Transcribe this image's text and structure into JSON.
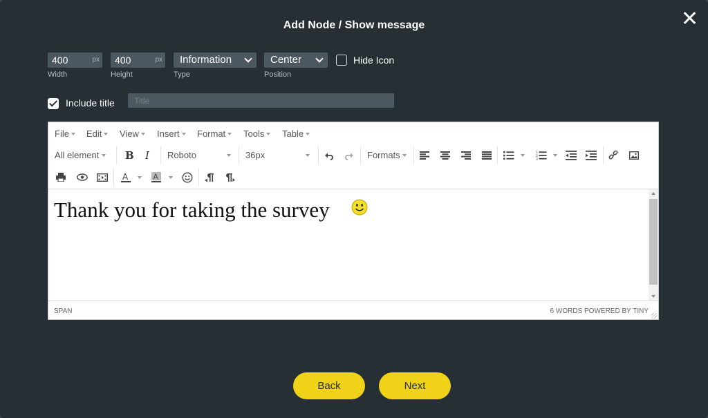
{
  "dialog": {
    "title": "Add Node / Show message"
  },
  "settings": {
    "width": {
      "value": "400",
      "unit": "px",
      "caption": "Width"
    },
    "height": {
      "value": "400",
      "unit": "px",
      "caption": "Height"
    },
    "type": {
      "value": "Information",
      "caption": "Type"
    },
    "position": {
      "value": "Center",
      "caption": "Position"
    },
    "hide_icon": {
      "label": "Hide Icon",
      "checked": false
    }
  },
  "include_title": {
    "label": "Include title",
    "checked": true,
    "placeholder": "Title",
    "value": ""
  },
  "editor": {
    "menu": [
      "File",
      "Edit",
      "View",
      "Insert",
      "Format",
      "Tools",
      "Table"
    ],
    "toolbar": {
      "block": "All element",
      "bold": "B",
      "italic": "I",
      "font": "Roboto",
      "size": "36px",
      "formats": "Formats"
    },
    "content": "Thank you for taking the survey",
    "status_path": "SPAN",
    "status_right": "6 WORDS POWERED BY TINY"
  },
  "footer": {
    "back": "Back",
    "next": "Next"
  },
  "colors": {
    "background": "#252f34",
    "accent": "#f0d219",
    "field": "#4c5860"
  }
}
